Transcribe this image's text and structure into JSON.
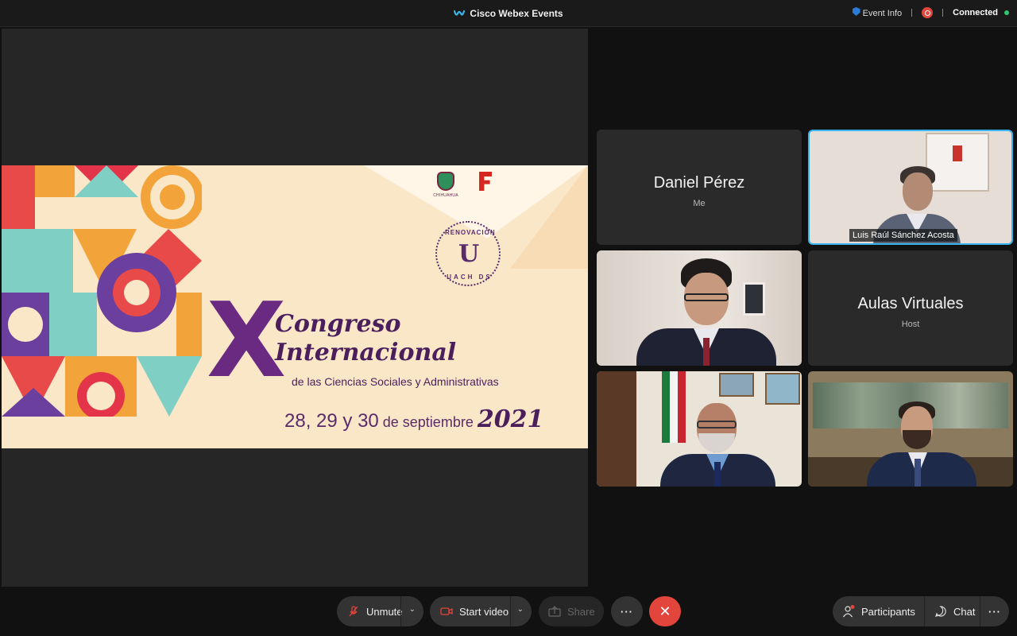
{
  "app": {
    "title": "Cisco Webex Events",
    "event_info": "Event Info",
    "status": "Connected",
    "colors": {
      "accent": "#3ab4ef",
      "leave": "#e2453c",
      "connected": "#2ec866"
    }
  },
  "shared_content": {
    "logo_left_caption": "CHIHUAHUA",
    "renovacion_top": "RENOVACIÓN",
    "renovacion_mark": "U",
    "renovacion_bottom": "UACH DS",
    "big_numeral": "X",
    "line1": "Congreso",
    "line2": "Internacional",
    "subtitle": "de las Ciencias Sociales y Administrativas",
    "dates": "28, 29 y 30",
    "dates_de": " de septiembre ",
    "year": "2021"
  },
  "tiles": [
    {
      "name": "Daniel Pérez",
      "role": "Me"
    },
    {
      "name": "Luis Raúl Sánchez Acosta"
    },
    {
      "name": "Aulas Virtuales",
      "role": "Host"
    }
  ],
  "toolbar": {
    "unmute": "Unmute",
    "start_video": "Start video",
    "share": "Share",
    "more": "···",
    "leave": "✕",
    "participants": "Participants",
    "chat": "Chat",
    "more_right": "···"
  }
}
